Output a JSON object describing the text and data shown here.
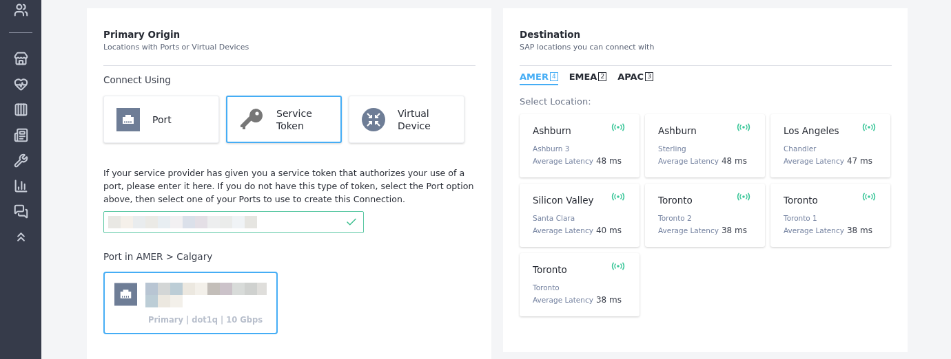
{
  "sidebar": {
    "items": [
      {
        "kind": "users"
      },
      {
        "kind": "divider"
      },
      {
        "kind": "store"
      },
      {
        "kind": "health"
      },
      {
        "kind": "pillars"
      },
      {
        "kind": "news"
      },
      {
        "kind": "tools"
      },
      {
        "kind": "chart"
      },
      {
        "kind": "chat"
      },
      {
        "kind": "layers"
      }
    ]
  },
  "origin": {
    "title": "Primary Origin",
    "subtitle": "Locations with Ports or Virtual Devices",
    "connect_label": "Connect Using",
    "options": [
      {
        "kind": "port",
        "label": "Port",
        "selected": false
      },
      {
        "kind": "token",
        "label": "Service Token",
        "selected": true
      },
      {
        "kind": "virtual",
        "label": "Virtual Device",
        "selected": false
      }
    ],
    "help": "If your service provider has given you a service token that authorizes your use of a port, please enter it here. If you do not have this type of token, select the Port option above, then select one of your Ports to use to create this Connection.",
    "token_field": {
      "valid": true
    },
    "port_label": "Port in AMER > Calgary",
    "port_card": {
      "details": "Primary | dot1q | 10 Gbps",
      "selected": true
    }
  },
  "destination": {
    "title": "Destination",
    "subtitle": "SAP locations you can connect with",
    "tabs": [
      {
        "label": "AMER",
        "count": "4",
        "selected": true
      },
      {
        "label": "EMEA",
        "count": "2",
        "selected": false
      },
      {
        "label": "APAC",
        "count": "3",
        "selected": false
      }
    ],
    "select_label": "Select Location:",
    "locations": [
      {
        "city": "Ashburn",
        "site": "Ashburn 3",
        "latency_label": "Average Latency",
        "latency": "48 ms"
      },
      {
        "city": "Ashburn",
        "site": "Sterling",
        "latency_label": "Average Latency",
        "latency": "48 ms"
      },
      {
        "city": "Los Angeles",
        "site": "Chandler",
        "latency_label": "Average Latency",
        "latency": "47 ms"
      },
      {
        "city": "Silicon Valley",
        "site": "Santa Clara",
        "latency_label": "Average Latency",
        "latency": "40 ms"
      },
      {
        "city": "Toronto",
        "site": "Toronto 2",
        "latency_label": "Average Latency",
        "latency": "38 ms"
      },
      {
        "city": "Toronto",
        "site": "Toronto 1",
        "latency_label": "Average Latency",
        "latency": "38 ms"
      },
      {
        "city": "Toronto",
        "site": "Toronto",
        "latency_label": "Average Latency",
        "latency": "38 ms"
      }
    ]
  }
}
